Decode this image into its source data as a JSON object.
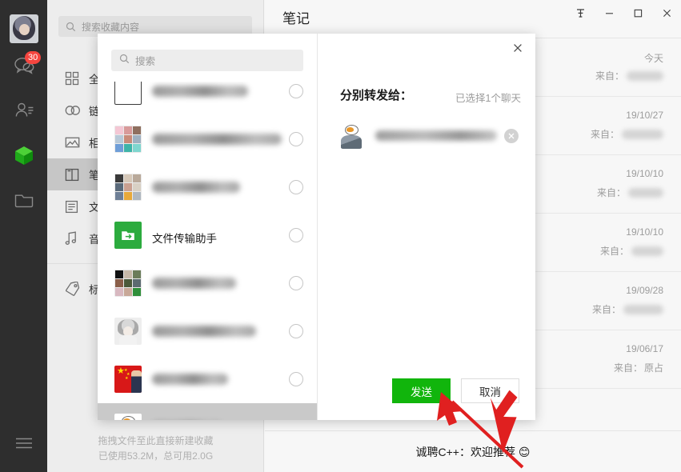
{
  "window": {
    "controls": [
      {
        "name": "pin-button",
        "glyph": "─"
      },
      {
        "name": "minimize-button",
        "glyph": "−"
      },
      {
        "name": "maximize-button",
        "glyph": "□"
      },
      {
        "name": "close-button",
        "glyph": "✕"
      }
    ]
  },
  "rail": {
    "avatar_alt": "user-avatar",
    "chat_badge": "30",
    "items": [
      {
        "name": "chats",
        "icon": "chat-bubble-icon"
      },
      {
        "name": "contacts",
        "icon": "contacts-icon"
      },
      {
        "name": "favorites",
        "icon": "favorites-cube-icon"
      },
      {
        "name": "files",
        "icon": "folder-icon"
      }
    ],
    "menu_icon": "hamburger-menu-icon"
  },
  "sidebar": {
    "search": {
      "placeholder": "搜索收藏内容",
      "value": "",
      "icon": "search-icon"
    },
    "items": [
      {
        "label": "全部",
        "icon": "grid-icon",
        "active": false
      },
      {
        "label": "链接",
        "icon": "link-icon",
        "active": false
      },
      {
        "label": "相册",
        "icon": "image-icon",
        "active": false
      },
      {
        "label": "笔记",
        "icon": "note-icon",
        "active": true
      },
      {
        "label": "文件",
        "icon": "file-icon",
        "active": false
      },
      {
        "label": "音乐",
        "icon": "music-icon",
        "active": false
      }
    ],
    "tag_item": {
      "label": "标签",
      "icon": "tag-icon"
    },
    "footer": {
      "hint": "拖拽文件至此直接新建收藏",
      "storage": "已使用53.2M，总可用2.0G"
    }
  },
  "main": {
    "title": "笔记",
    "from_label": "来自：",
    "rows": [
      {
        "date": "今天",
        "from": "",
        "from_blurred": true,
        "blur_width": 46
      },
      {
        "date": "19/10/27",
        "from": "",
        "from_blurred": true,
        "blur_width": 52
      },
      {
        "date": "19/10/10",
        "from": "",
        "from_blurred": true,
        "blur_width": 44
      },
      {
        "date": "19/10/10",
        "from": "",
        "from_blurred": true,
        "blur_width": 40
      },
      {
        "date": "19/09/28",
        "from": "",
        "from_blurred": true,
        "blur_width": 50
      },
      {
        "date": "19/06/17",
        "from": "原占",
        "from_blurred": false,
        "blur_width": 0
      }
    ],
    "ad_text": "诚聘C++：欢迎推荐 😊"
  },
  "modal": {
    "close_icon": "close-icon",
    "search": {
      "placeholder": "搜索",
      "value": "",
      "icon": "search-icon"
    },
    "title": "分别转发给：",
    "selected_count_text": "已选择1个聊天",
    "contacts": [
      {
        "avatar": "partial-row",
        "name": "",
        "blurred": true,
        "selected": false,
        "partial": true,
        "blur_width": 120
      },
      {
        "avatar": "group-grid-a",
        "name": "",
        "blurred": true,
        "selected": false,
        "blur_width": 162
      },
      {
        "avatar": "group-grid-b",
        "name": "",
        "blurred": true,
        "selected": false,
        "blur_width": 110
      },
      {
        "avatar": "file-transfer",
        "name": "文件传输助手",
        "blurred": false,
        "selected": false,
        "blur_width": 0
      },
      {
        "avatar": "group-grid-c",
        "name": "",
        "blurred": true,
        "selected": false,
        "blur_width": 105
      },
      {
        "avatar": "girl",
        "name": "",
        "blurred": true,
        "selected": false,
        "blur_width": 130
      },
      {
        "avatar": "flag",
        "name": "",
        "blurred": true,
        "selected": false,
        "blur_width": 95
      },
      {
        "avatar": "anime-goose",
        "name": "",
        "blurred": true,
        "selected": true,
        "blur_width": 88
      }
    ],
    "selected_chip": {
      "avatar": "anime-goose",
      "name": "",
      "blurred": true,
      "remove_icon": "remove-icon"
    },
    "send_label": "发送",
    "cancel_label": "取消"
  },
  "colors": {
    "accent_green": "#11b50c",
    "check_green": "#09bb07",
    "badge_red": "#f5453f",
    "rail_dark": "#2e2e2e",
    "sidebar_bg": "#ededed",
    "cursor_red": "#e02020"
  }
}
